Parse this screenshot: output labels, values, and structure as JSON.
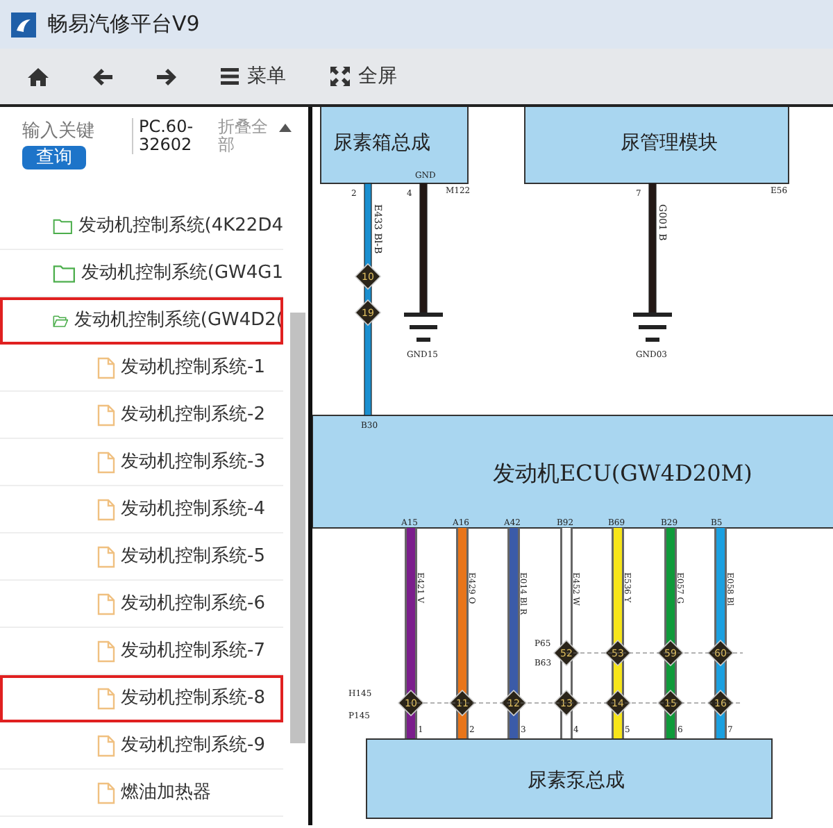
{
  "window": {
    "title": "畅易汽修平台V9"
  },
  "toolbar": [
    {
      "kind": "home"
    },
    {
      "kind": "back"
    },
    {
      "kind": "forward"
    },
    {
      "kind": "menu",
      "label": "菜单"
    },
    {
      "kind": "fullscreen",
      "label": "全屏"
    }
  ],
  "sidebar": {
    "search": {
      "placeholder": "输入关键"
    },
    "search_button": "查询",
    "code": "PC.60-32602",
    "collapse_all": "折叠全部",
    "tree": [
      {
        "label": "发动机控制系统(4K22D4",
        "kind": "folder",
        "highlighted": false
      },
      {
        "label": "发动机控制系统(GW4G1",
        "kind": "folder",
        "highlighted": false
      },
      {
        "label": "发动机控制系统(GW4D2(",
        "kind": "folder",
        "expanded": true,
        "highlighted": true,
        "children": [
          {
            "label": "发动机控制系统-1",
            "kind": "file",
            "highlighted": false
          },
          {
            "label": "发动机控制系统-2",
            "kind": "file",
            "highlighted": false
          },
          {
            "label": "发动机控制系统-3",
            "kind": "file",
            "highlighted": false
          },
          {
            "label": "发动机控制系统-4",
            "kind": "file",
            "highlighted": false
          },
          {
            "label": "发动机控制系统-5",
            "kind": "file",
            "highlighted": false
          },
          {
            "label": "发动机控制系统-6",
            "kind": "file",
            "highlighted": false
          },
          {
            "label": "发动机控制系统-7",
            "kind": "file",
            "highlighted": false
          },
          {
            "label": "发动机控制系统-8",
            "kind": "file",
            "highlighted": true
          },
          {
            "label": "发动机控制系统-9",
            "kind": "file",
            "highlighted": false
          },
          {
            "label": "燃油加热器",
            "kind": "file",
            "highlighted": false
          }
        ]
      }
    ]
  },
  "diagram": {
    "modules": [
      {
        "label": "尿素箱总成",
        "pin_label": "GND",
        "connector": "M122"
      },
      {
        "label": "尿管理模块",
        "connector": "E56"
      }
    ],
    "upper_wires": [
      {
        "pin": "2",
        "code": "E433 Bl-B",
        "color": "#1a8fd0",
        "connectors": [
          "10",
          "19"
        ],
        "end": "B30"
      },
      {
        "pin": "4",
        "color": "#231815",
        "ground": "GND15"
      },
      {
        "pin": "7",
        "code": "G001 B",
        "color": "#231815",
        "ground": "GND03"
      }
    ],
    "ecu": "发动机ECU(GW4D20M)",
    "pins": [
      {
        "pin": "A15",
        "code": "E421 V",
        "color": "#7b1e8c",
        "conn": "10",
        "num": "1"
      },
      {
        "pin": "A16",
        "code": "E429 O",
        "color": "#e8751a",
        "conn": "11",
        "num": "2"
      },
      {
        "pin": "A42",
        "code": "E014 Bl R",
        "color": "#3b5ba8",
        "conn": "12",
        "num": "3"
      },
      {
        "pin": "B92",
        "code": "E452 W",
        "color": "#ffffff",
        "conn": "13",
        "upper": "52",
        "num": "4"
      },
      {
        "pin": "B69",
        "code": "E536 Y",
        "color": "#f7e51a",
        "conn": "14",
        "upper": "53",
        "num": "5"
      },
      {
        "pin": "B29",
        "code": "E057 G",
        "color": "#0f9a3a",
        "conn": "15",
        "upper": "59",
        "num": "6"
      },
      {
        "pin": "B5",
        "code": "E058 Bl",
        "color": "#1ba0e0",
        "conn": "16",
        "upper": "60",
        "num": "7"
      }
    ],
    "row_labels": [
      "P65",
      "B63",
      "H145",
      "P145"
    ],
    "bottom_module": "尿素泵总成"
  }
}
